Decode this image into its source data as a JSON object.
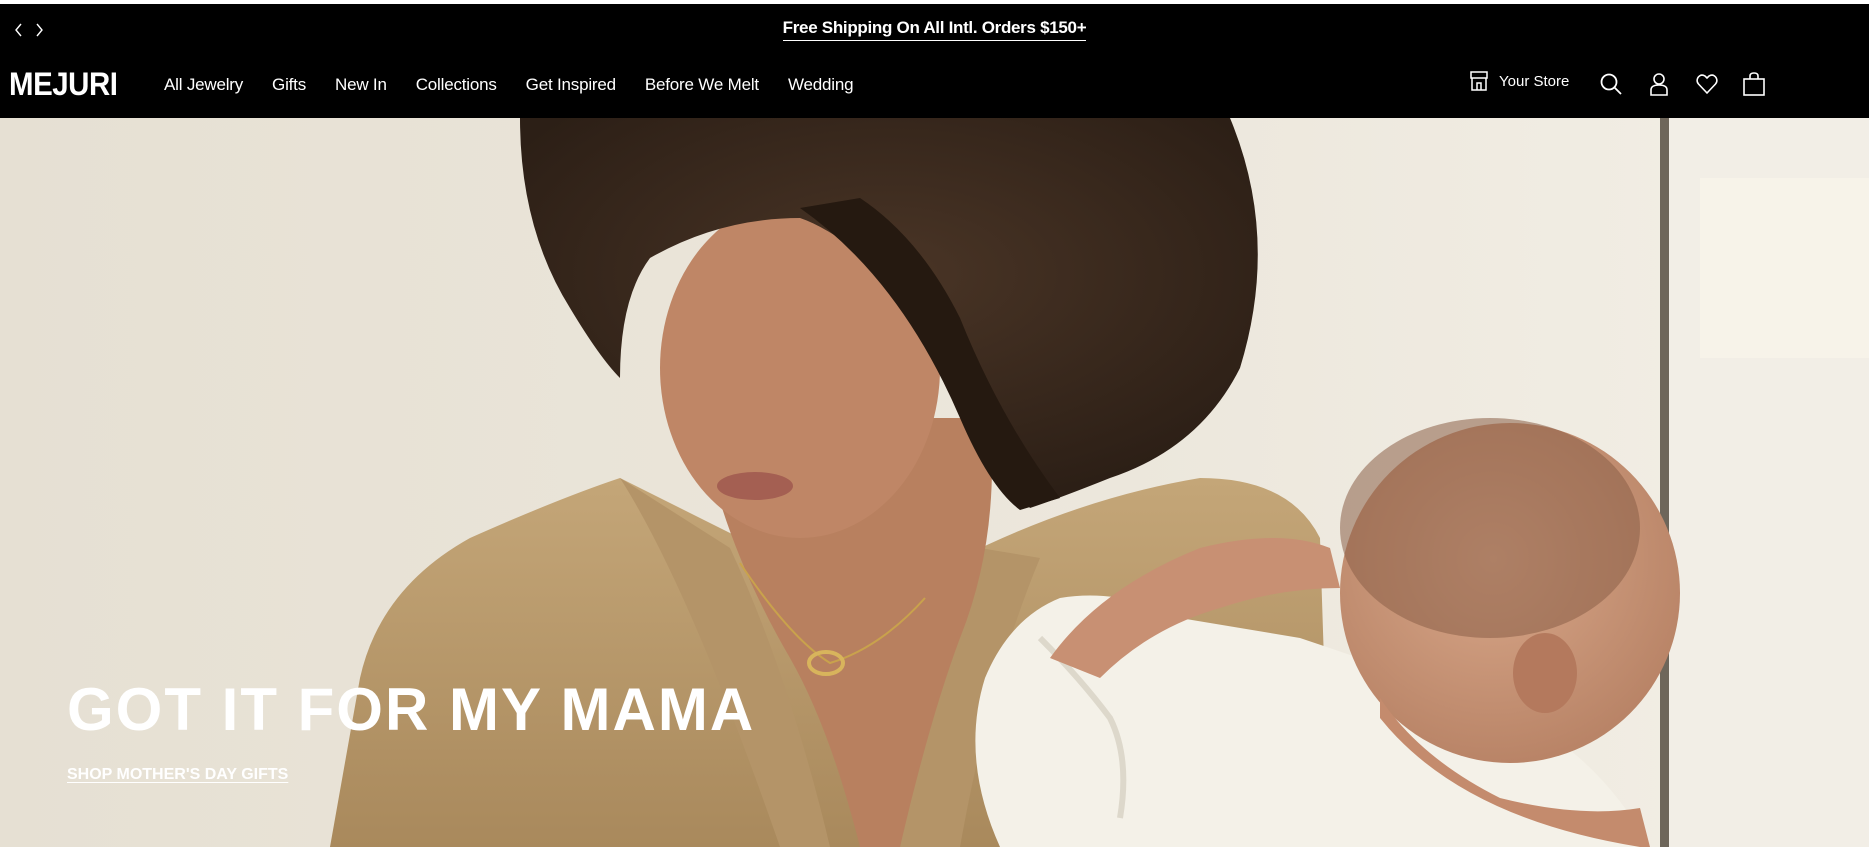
{
  "announcement": {
    "text": "Free Shipping On All Intl. Orders $150+",
    "prev_icon": "chevron-left-icon",
    "next_icon": "chevron-right-icon"
  },
  "header": {
    "logo": "MEJURI",
    "nav": [
      {
        "label": "All Jewelry"
      },
      {
        "label": "Gifts"
      },
      {
        "label": "New In"
      },
      {
        "label": "Collections"
      },
      {
        "label": "Get Inspired"
      },
      {
        "label": "Before We Melt"
      },
      {
        "label": "Wedding"
      }
    ],
    "store_label": "Your Store",
    "icons": [
      "store-icon",
      "search-icon",
      "account-icon",
      "heart-icon",
      "bag-icon"
    ]
  },
  "hero": {
    "title": "GOT IT FOR MY MAMA",
    "cta": "SHOP MOTHER'S DAY GIFTS"
  },
  "colors": {
    "header_bg": "#000000",
    "header_text": "#ffffff",
    "hero_wall": "#e9e4d8",
    "shirt": "#b89a6c",
    "hair": "#3a2a1e",
    "skin": "#b57a5a",
    "baby_shirt": "#f4f1e8"
  }
}
